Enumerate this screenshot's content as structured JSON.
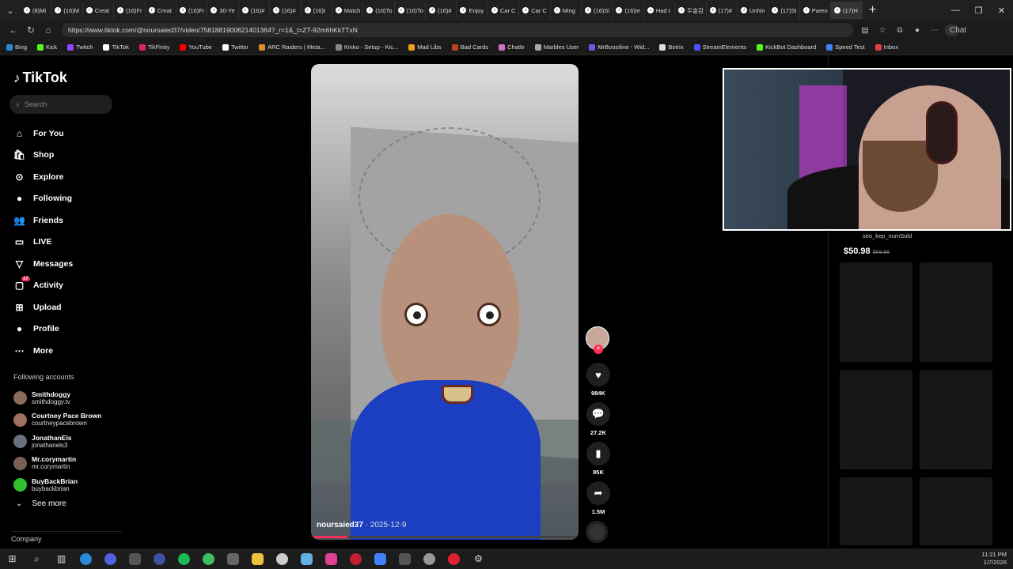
{
  "browser": {
    "tabs": [
      "(8)Mi",
      "(16)M",
      "Creat",
      "(16)Fr",
      "Creat",
      "(16)Fr",
      "30-Ye",
      "(16)#",
      "(16)#",
      "(16)t",
      "Match",
      "(16)To",
      "(16)To",
      "(16)#",
      "Enjoy",
      "Car C",
      "Car C",
      "Ming",
      "(16)Si",
      "(16)Ie",
      "Had t",
      "두술감",
      "(17)#",
      "Unhin",
      "(17)Si",
      "Paren",
      "(17)H"
    ],
    "url": "https://www.tiktok.com/@noursaied37/video/7581881900621401364?_r=1&_t=ZT-92m6hKkTTxN",
    "chat_label": "Chat",
    "bookmarks": [
      {
        "label": "Bing",
        "color": "#2a88d8"
      },
      {
        "label": "Kick",
        "color": "#53fc18"
      },
      {
        "label": "Twitch",
        "color": "#9146ff"
      },
      {
        "label": "TikTok",
        "color": "#ffffff"
      },
      {
        "label": "TikFinity",
        "color": "#e0245e"
      },
      {
        "label": "YouTube",
        "color": "#ff0000"
      },
      {
        "label": "Twitter",
        "color": "#ffffff"
      },
      {
        "label": "ARC Raiders | Meta...",
        "color": "#e08a30"
      },
      {
        "label": "Kinko - Setup - Kic...",
        "color": "#888888"
      },
      {
        "label": "Mad Libs",
        "color": "#f0a020"
      },
      {
        "label": "Bad Cards",
        "color": "#c04020"
      },
      {
        "label": "Chatle",
        "color": "#d070c0"
      },
      {
        "label": "Marbles User",
        "color": "#aaaaaa"
      },
      {
        "label": "MrBoostlive - Wid...",
        "color": "#6060e0"
      },
      {
        "label": "Botrix",
        "color": "#dddddd"
      },
      {
        "label": "StreamElements",
        "color": "#5050ff"
      },
      {
        "label": "KickBot Dashboard",
        "color": "#53fc18"
      },
      {
        "label": "Speed Test",
        "color": "#4080ff"
      },
      {
        "label": "Inbox",
        "color": "#e04040"
      }
    ]
  },
  "tiktok": {
    "logo": "TikTok",
    "search_placeholder": "Search",
    "nav": [
      {
        "label": "For You",
        "icon": "home-icon",
        "glyph": "⌂"
      },
      {
        "label": "Shop",
        "icon": "shop-icon",
        "glyph": "🛍"
      },
      {
        "label": "Explore",
        "icon": "compass-icon",
        "glyph": "⊙"
      },
      {
        "label": "Following",
        "icon": "following-avatar-icon",
        "glyph": "●"
      },
      {
        "label": "Friends",
        "icon": "friends-icon",
        "glyph": "👥"
      },
      {
        "label": "LIVE",
        "icon": "live-icon",
        "glyph": "▭"
      },
      {
        "label": "Messages",
        "icon": "messages-icon",
        "glyph": "▽"
      },
      {
        "label": "Activity",
        "icon": "activity-icon",
        "glyph": "▢",
        "badge": "17"
      },
      {
        "label": "Upload",
        "icon": "upload-icon",
        "glyph": "⊞"
      },
      {
        "label": "Profile",
        "icon": "profile-avatar-icon",
        "glyph": "●"
      },
      {
        "label": "More",
        "icon": "more-icon",
        "glyph": "⋯"
      }
    ],
    "following_title": "Following accounts",
    "accounts": [
      {
        "name": "Smithdoggy",
        "handle": "smithdoggy.tv"
      },
      {
        "name": "Courtney Pace Brown",
        "handle": "courtneypacebrown"
      },
      {
        "name": "JonathanEls",
        "handle": "jonathanels3"
      },
      {
        "name": "Mr.corymartin",
        "handle": "mr.corymartin"
      },
      {
        "name": "BuyBackBrian",
        "handle": "buybackbrian"
      }
    ],
    "see_more": "See more",
    "company": "Company",
    "video": {
      "author": "noursaied37",
      "date": "· 2025-12-9",
      "progress": 0.13
    },
    "actions": {
      "likes": "984K",
      "comments": "27.2K",
      "saves": "85K",
      "shares": "1.5M"
    },
    "shop": {
      "label": "seo_kep_numSold",
      "price": "$50.98",
      "old_price": "$69.99"
    }
  },
  "taskbar": {
    "time": "11:21 PM",
    "date": "1/7/2026"
  }
}
